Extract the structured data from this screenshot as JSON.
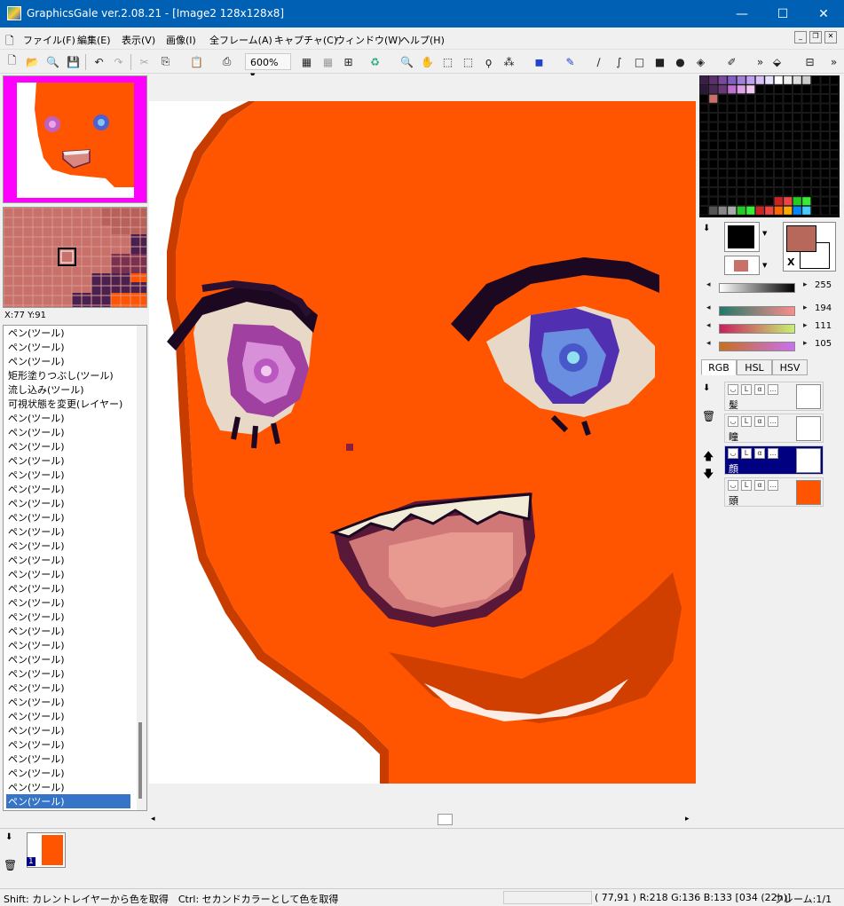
{
  "window": {
    "title": "GraphicsGale ver.2.08.21 - [Image2 128x128x8]",
    "minimize_glyph": "—",
    "maximize_glyph": "☐",
    "close_glyph": "✕"
  },
  "menu": {
    "items": [
      "ファイル(F)",
      "編集(E)",
      "表示(V)",
      "画像(I)",
      "全フレーム(A)",
      "キャプチャ(C)",
      "ウィンドウ(W)",
      "ヘルプ(H)"
    ]
  },
  "toolbar": {
    "zoom": "600%"
  },
  "navigator": {
    "coords": "X:77 Y:91"
  },
  "history": {
    "items": [
      "ペン(ツール)",
      "ペン(ツール)",
      "ペン(ツール)",
      "矩形塗りつぶし(ツール)",
      "流し込み(ツール)",
      "可視状態を変更(レイヤー)",
      "ペン(ツール)",
      "ペン(ツール)",
      "ペン(ツール)",
      "ペン(ツール)",
      "ペン(ツール)",
      "ペン(ツール)",
      "ペン(ツール)",
      "ペン(ツール)",
      "ペン(ツール)",
      "ペン(ツール)",
      "ペン(ツール)",
      "ペン(ツール)",
      "ペン(ツール)",
      "ペン(ツール)",
      "ペン(ツール)",
      "ペン(ツール)",
      "ペン(ツール)",
      "ペン(ツール)",
      "ペン(ツール)",
      "ペン(ツール)",
      "ペン(ツール)",
      "ペン(ツール)",
      "ペン(ツール)",
      "ペン(ツール)",
      "ペン(ツール)",
      "ペン(ツール)",
      "ペン(ツール)",
      "ペン(ツール)"
    ],
    "selected_index": 33
  },
  "color": {
    "primary_hex": "#000000",
    "secondary_hex": "#c8706a",
    "gray_value": "255",
    "r_value": "194",
    "g_value": "111",
    "b_value": "105",
    "swap_label": "X"
  },
  "mode_tabs": [
    "RGB",
    "HSL",
    "HSV"
  ],
  "layers": [
    {
      "name": "髪",
      "selected": false
    },
    {
      "name": "瞳",
      "selected": false
    },
    {
      "name": "顔",
      "selected": true
    },
    {
      "name": "頭",
      "selected": false
    }
  ],
  "frames": {
    "label": "1"
  },
  "status": {
    "hint": "Shift: カレントレイヤーから色を取得　Ctrl: セカンドカラーとして色を取得",
    "pixel_info": "( 77,91 ) R:218 G:136 B:133  [034 (22h)]",
    "frame_info": "フレーム:1/1"
  },
  "colors": {
    "skin": "#ff5500",
    "skin_dark": "#c83c00",
    "accent_selection": "#3574c6",
    "layer_selected_bg": "#000080",
    "magenta_bg": "#ff00ff"
  }
}
